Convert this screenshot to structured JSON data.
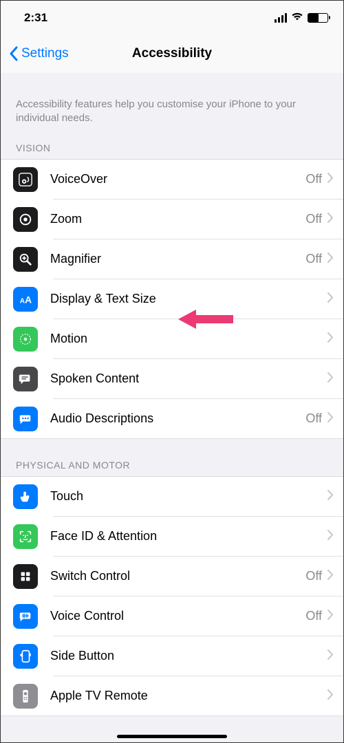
{
  "status": {
    "time": "2:31"
  },
  "nav": {
    "back": "Settings",
    "title": "Accessibility"
  },
  "intro": "Accessibility features help you customise your iPhone to your individual needs.",
  "sections": {
    "vision": {
      "label": "VISION",
      "items": [
        {
          "label": "VoiceOver",
          "value": "Off"
        },
        {
          "label": "Zoom",
          "value": "Off"
        },
        {
          "label": "Magnifier",
          "value": "Off"
        },
        {
          "label": "Display & Text Size",
          "value": ""
        },
        {
          "label": "Motion",
          "value": ""
        },
        {
          "label": "Spoken Content",
          "value": ""
        },
        {
          "label": "Audio Descriptions",
          "value": "Off"
        }
      ]
    },
    "physical": {
      "label": "PHYSICAL AND MOTOR",
      "items": [
        {
          "label": "Touch",
          "value": ""
        },
        {
          "label": "Face ID & Attention",
          "value": ""
        },
        {
          "label": "Switch Control",
          "value": "Off"
        },
        {
          "label": "Voice Control",
          "value": "Off"
        },
        {
          "label": "Side Button",
          "value": ""
        },
        {
          "label": "Apple TV Remote",
          "value": ""
        }
      ]
    }
  }
}
